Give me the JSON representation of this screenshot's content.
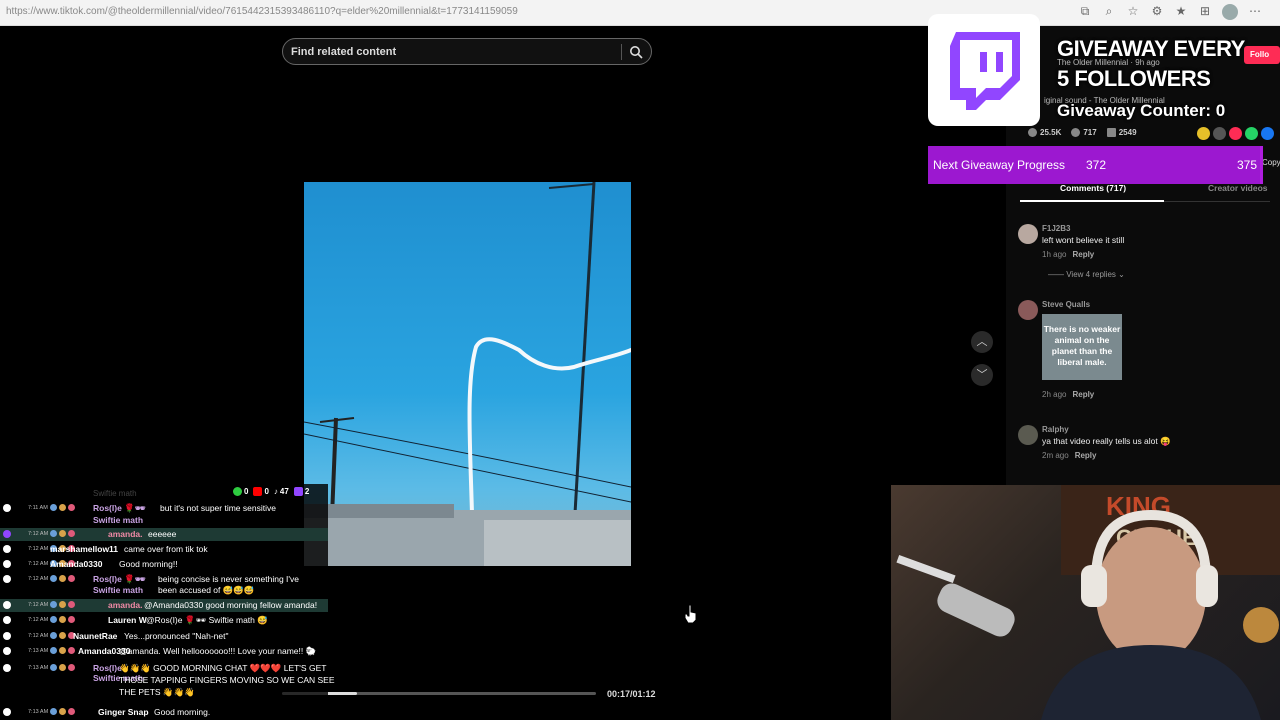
{
  "browser": {
    "url": "https://www.tiktok.com/@theoldermillennial/video/7615442315393486110?q=elder%20millennial&t=1773141159059",
    "icons": [
      "open-in-new-icon",
      "zoom-icon",
      "star-icon",
      "extension-icon",
      "favorites-icon",
      "collections-icon",
      "profile-icon",
      "more-icon"
    ]
  },
  "search": {
    "placeholder": "Find related content"
  },
  "video": {
    "progress": 0.24,
    "timecode": "00:17/01:12"
  },
  "post": {
    "author_line": "The Older Millennial · 9h ago",
    "follow_label": "Follo",
    "sound": "iginal sound - The Older Millennial",
    "likes": "25.5K",
    "comments": "717",
    "saves": "2549",
    "partial": "Copy l"
  },
  "tabs": {
    "comments": "Comments (717)",
    "creator": "Creator videos"
  },
  "comments": [
    {
      "user": "F1J2B3",
      "text": "left wont believe it still",
      "time": "1h ago",
      "reply": "Reply",
      "view_replies": "View 4 replies"
    },
    {
      "user": "Steve Qualls",
      "meme": "There is no weaker animal on the planet than the liberal male.",
      "time": "2h ago",
      "reply": "Reply"
    },
    {
      "user": "Ralphy",
      "text": "ya that video really tells us alot 😝",
      "time": "2m ago",
      "reply": "Reply"
    }
  ],
  "overlay": {
    "giveaway_line1": "GIVEAWAY EVERY",
    "giveaway_line2": "5 FOLLOWERS",
    "counter_label": "Giveaway Counter: 0",
    "next_label": "Next Giveaway Progress",
    "next_current": "372",
    "next_goal": "375",
    "next_fraction": 0.992
  },
  "chat": {
    "counts": {
      "youtube_green": "0",
      "youtube": "0",
      "tiktok": "47",
      "twitch": "2"
    },
    "faded_header": "Swiftie math",
    "messages": [
      {
        "time": "7:11 AM",
        "user": "Ros(I)e 🌹🕶",
        "sub": "Swiftie math",
        "text": "but it's not super time sensitive",
        "color": "#c9a3e3"
      },
      {
        "time": "7:12 AM",
        "user": "amanda.",
        "text": "eeeeee",
        "color": "#f08aa6",
        "hl": true
      },
      {
        "time": "7:12 AM",
        "user": "marshamellow11",
        "text": "came over from tik tok",
        "color": "#fff"
      },
      {
        "time": "7:12 AM",
        "user": "Amanda0330",
        "text": "Good morning!!",
        "color": "#fff"
      },
      {
        "time": "7:12 AM",
        "user": "Ros(I)e 🌹🕶",
        "sub": "Swiftie math",
        "text": "being concise is never something I've",
        "text2": "been accused of 😅😅😅",
        "color": "#c9a3e3"
      },
      {
        "time": "7:12 AM",
        "user": "amanda.",
        "text": "@Amanda0330 good morning fellow amanda!",
        "color": "#f08aa6",
        "hl": true
      },
      {
        "time": "7:12 AM",
        "user": "Lauren W",
        "text": "@Ros(I)e 🌹🕶 Swiftie math 😅",
        "color": "#fff"
      },
      {
        "time": "7:12 AM",
        "user": "NaunetRae",
        "text": "Yes...pronounced \"Nah-net\"",
        "color": "#fff"
      },
      {
        "time": "7:13 AM",
        "user": "Amanda0330",
        "text": "@amanda. Well hellooooooo!!! Love your name!! 🐑",
        "color": "#fff"
      },
      {
        "time": "7:13 AM",
        "user": "Ros(I)e",
        "sub": "Swiftie math",
        "text": "👋👋👋 GOOD MORNING CHAT ❤️❤️❤️ LET'S GET",
        "text2": "THOSE TAPPING FINGERS MOVING SO WE CAN SEE",
        "text3": "THE PETS 👋👋👋",
        "color": "#c9a3e3"
      },
      {
        "time": "7:13 AM",
        "user": "Ginger Snap",
        "text": "Good morning.",
        "color": "#fff"
      }
    ]
  },
  "colors": {
    "accent_purple": "#b01de0",
    "twitch_purple": "#9146ff",
    "tiktok_red": "#fe2c55"
  }
}
